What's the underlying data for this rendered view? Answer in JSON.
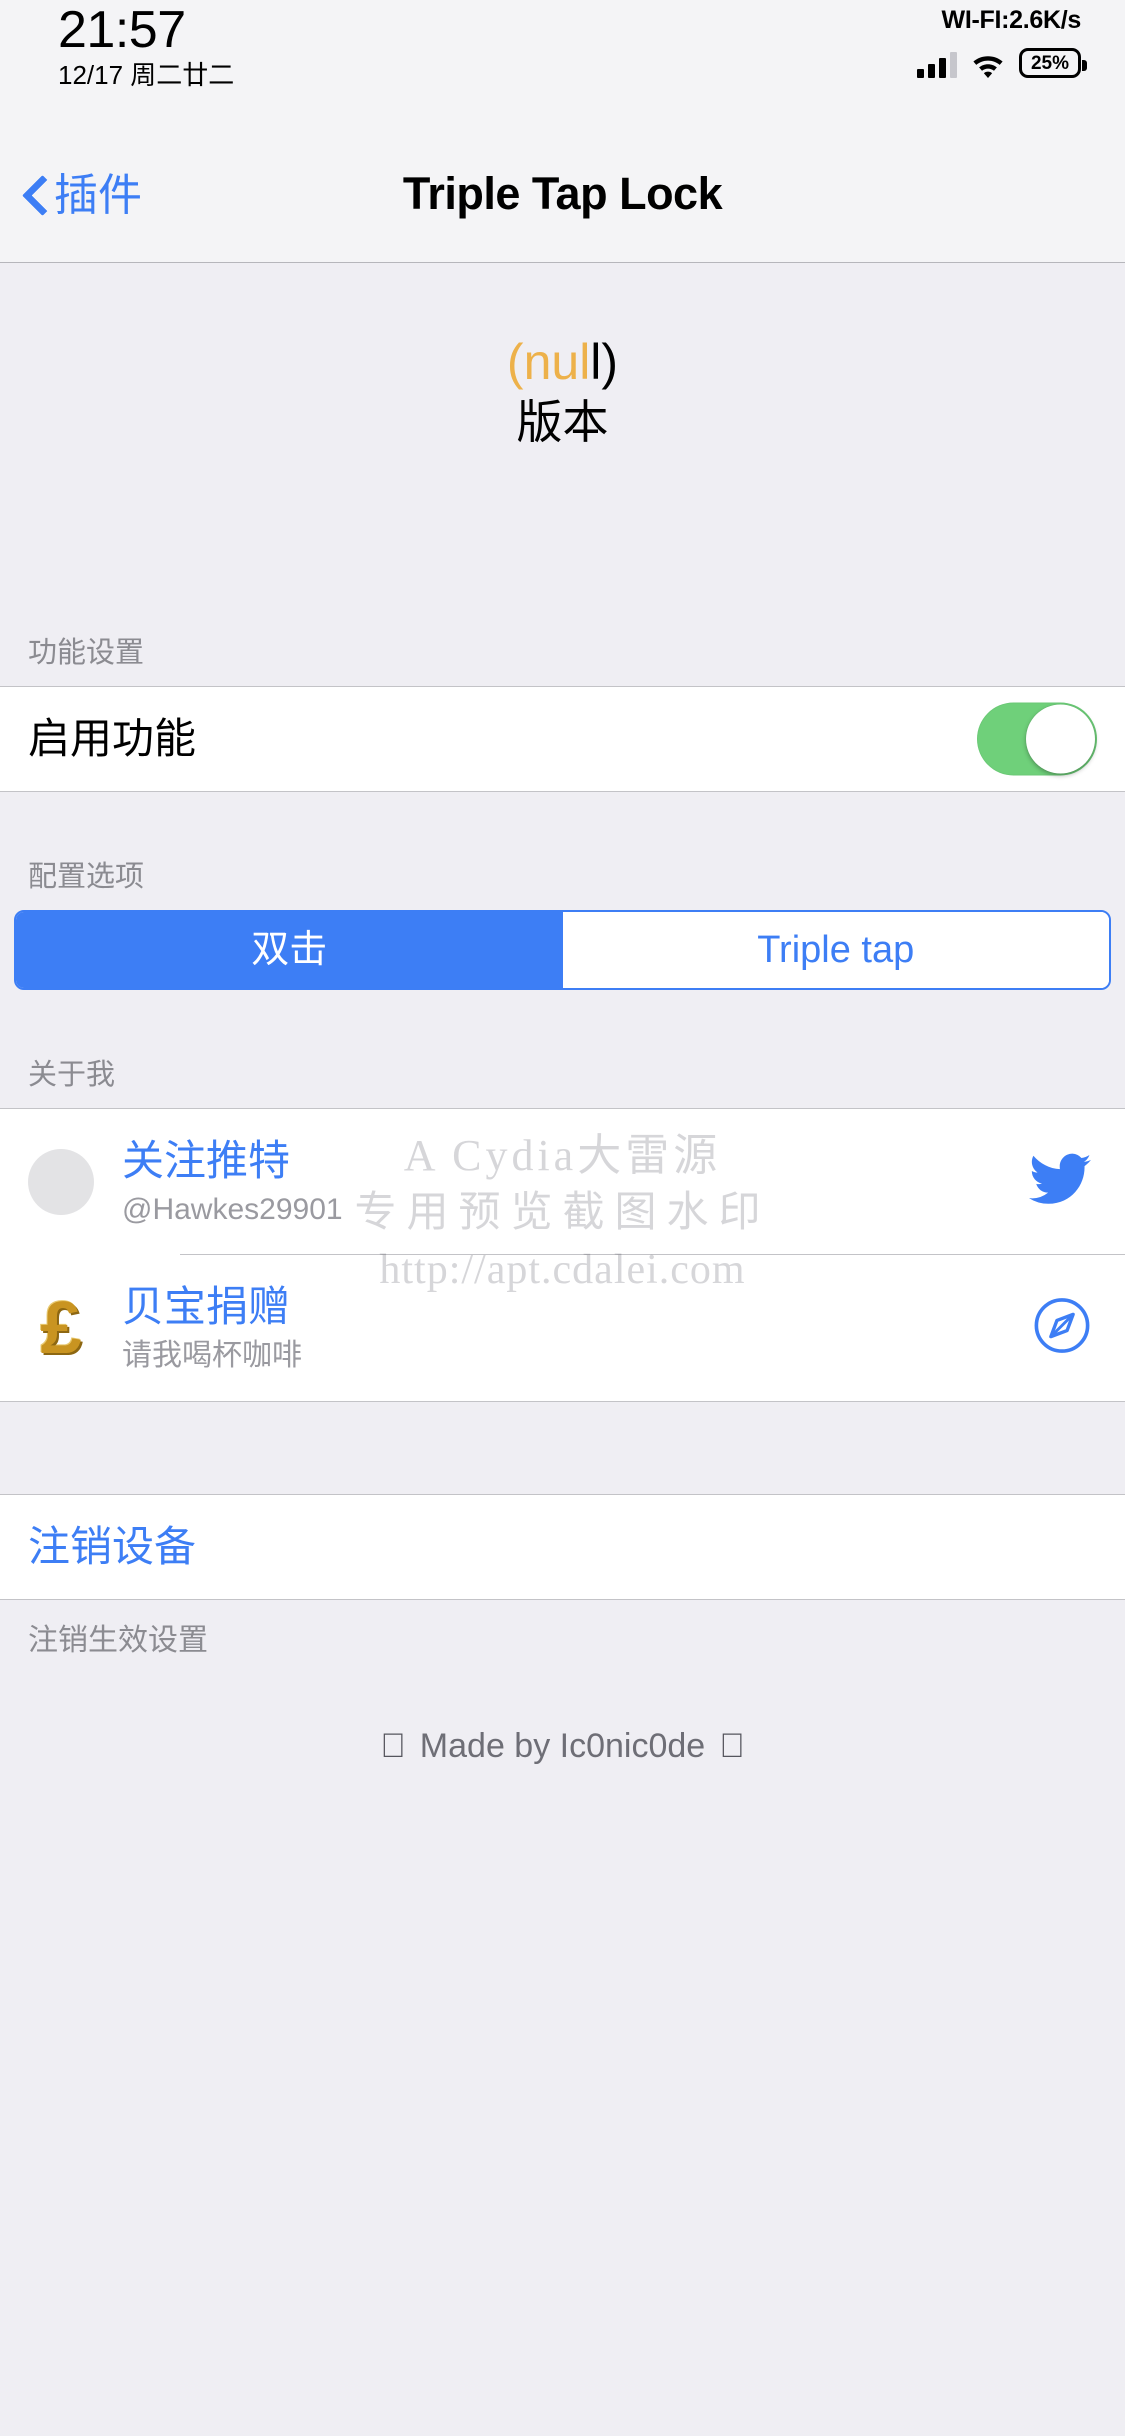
{
  "status_bar": {
    "time": "21:57",
    "date": "12/17  周二廿二",
    "network_speed": "WI-FI:2.6K/s",
    "battery_percent": "25%",
    "signal_icon": "signal-bars-icon",
    "wifi_icon": "wifi-icon",
    "battery_icon": "battery-icon"
  },
  "nav": {
    "back_label": "插件",
    "back_icon": "chevron-left-icon",
    "title": "Triple Tap Lock"
  },
  "version": {
    "value_prefix": "(nul",
    "value_suffix": "l)",
    "label": "版本",
    "accent_color": "#edb14a"
  },
  "sections": {
    "feature": {
      "header": "功能设置",
      "toggle_label": "启用功能",
      "toggle_state": "on",
      "toggle_color": "#6fd07a"
    },
    "config": {
      "header": "配置选项",
      "segments": [
        {
          "label": "双击",
          "selected": true
        },
        {
          "label": "Triple tap",
          "selected": false
        }
      ],
      "accent_color": "#3d7ef5"
    },
    "about": {
      "header": "关于我",
      "items": [
        {
          "title": "关注推特",
          "subtitle": "@Hawkes29901",
          "avatar_icon": "avatar-placeholder-icon",
          "accessory_icon": "twitter-bird-icon"
        },
        {
          "title": "贝宝捐赠",
          "subtitle": "请我喝杯咖啡",
          "avatar_icon": "pound-sterling-icon",
          "accessory_icon": "safari-compass-icon"
        }
      ]
    },
    "respring": {
      "action_label": "注销设备",
      "footnote": "注销生效设置"
    }
  },
  "footer": {
    "text": "Made by Ic0nic0de",
    "left_icon": "apple-logo-icon",
    "right_icon": "apple-logo-icon"
  },
  "watermark": {
    "line1": "A Cydia大雷源",
    "line2": "专用预览截图水印",
    "line3": "http://apt.cdalei.com"
  }
}
